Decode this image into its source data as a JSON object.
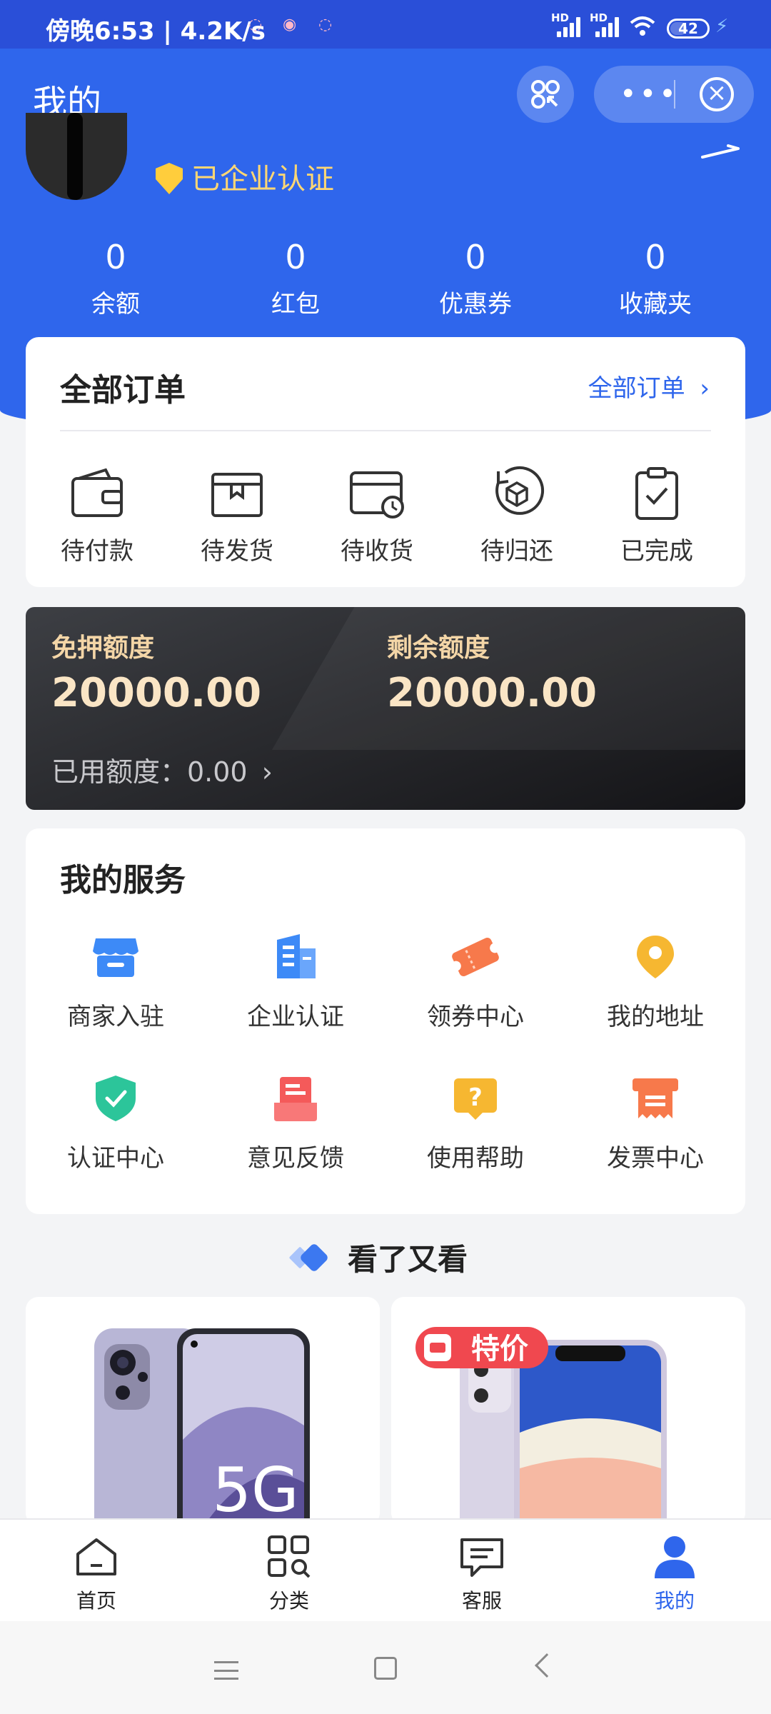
{
  "status_bar": {
    "time": "傍晚6:53 | 4.2K/s",
    "network_1": "HD",
    "network_2": "HD",
    "battery": "42"
  },
  "nav": {
    "title": "我的"
  },
  "profile": {
    "verify_label": "已企业认证"
  },
  "stats": [
    {
      "value": "0",
      "label": "余额"
    },
    {
      "value": "0",
      "label": "红包"
    },
    {
      "value": "0",
      "label": "优惠券"
    },
    {
      "value": "0",
      "label": "收藏夹"
    }
  ],
  "orders": {
    "title": "全部订单",
    "all_link": "全部订单",
    "items": [
      {
        "label": "待付款",
        "icon": "wallet-icon"
      },
      {
        "label": "待发货",
        "icon": "package-icon"
      },
      {
        "label": "待收货",
        "icon": "delivery-clock-icon"
      },
      {
        "label": "待归还",
        "icon": "return-box-icon"
      },
      {
        "label": "已完成",
        "icon": "clipboard-check-icon"
      }
    ]
  },
  "credit": {
    "free_deposit_label": "免押额度",
    "free_deposit_value": "20000.00",
    "remaining_label": "剩余额度",
    "remaining_value": "20000.00",
    "used_label": "已用额度：0.00"
  },
  "services": {
    "title": "我的服务",
    "items": [
      {
        "label": "商家入驻",
        "icon": "store-icon",
        "color": "#3d8af7"
      },
      {
        "label": "企业认证",
        "icon": "building-icon",
        "color": "#3d8af7"
      },
      {
        "label": "领券中心",
        "icon": "coupon-icon",
        "color": "#f7794b"
      },
      {
        "label": "我的地址",
        "icon": "location-icon",
        "color": "#f6b731"
      },
      {
        "label": "认证中心",
        "icon": "shield-check-icon",
        "color": "#2cc59a"
      },
      {
        "label": "意见反馈",
        "icon": "feedback-icon",
        "color": "#f45a5a"
      },
      {
        "label": "使用帮助",
        "icon": "help-icon",
        "color": "#f6b731"
      },
      {
        "label": "发票中心",
        "icon": "invoice-icon",
        "color": "#f7794b"
      }
    ]
  },
  "recommend": {
    "title": "看了又看",
    "product_1_badge": "5G",
    "product_2_badge": "特价"
  },
  "tabbar": {
    "items": [
      {
        "label": "首页",
        "icon": "home-icon"
      },
      {
        "label": "分类",
        "icon": "category-icon"
      },
      {
        "label": "客服",
        "icon": "chat-icon"
      },
      {
        "label": "我的",
        "icon": "user-icon"
      }
    ],
    "active_color": "#2f66ec"
  },
  "colors": {
    "brand_blue": "#2f66ec",
    "gold": "#ffd773"
  }
}
